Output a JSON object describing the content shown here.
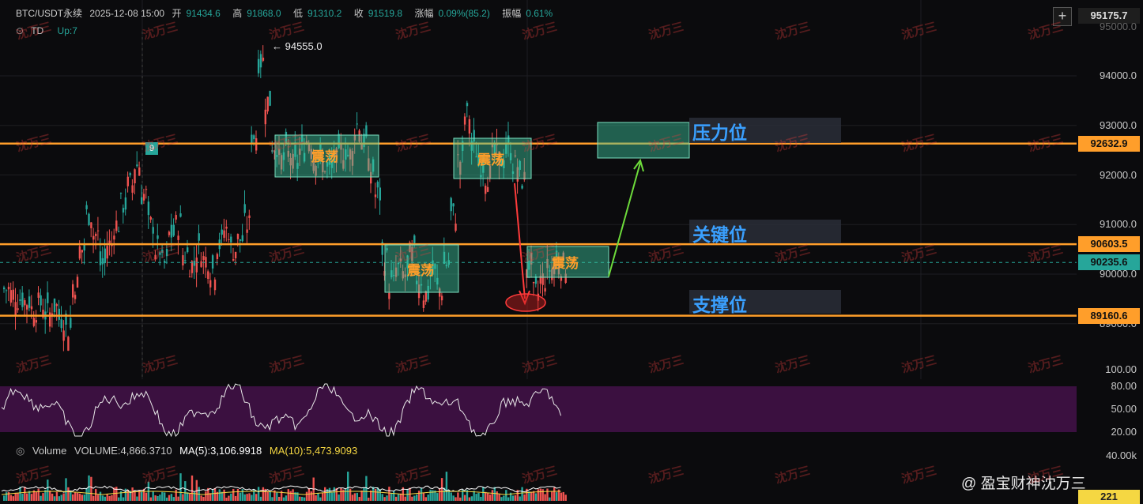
{
  "header": {
    "symbol": "BTC/USDT永续",
    "datetime": "2025-12-08 15:00",
    "open_label": "开",
    "open": "91434.6",
    "high_label": "高",
    "high": "91868.0",
    "low_label": "低",
    "low": "91310.2",
    "close_label": "收",
    "close": "91519.8",
    "change_label": "涨幅",
    "change": "0.09%(85.2)",
    "amp_label": "振幅",
    "amp": "0.61%",
    "indicator": "TD",
    "indicator_value": "Up:7"
  },
  "price_axis": {
    "ticks": [
      "94000.0",
      "93000.0",
      "92000.0",
      "91000.0",
      "90000.0",
      "89000.0"
    ],
    "top_price": "95175.7",
    "top_tick": "95000.0",
    "tags": [
      {
        "label": "92632.9",
        "color": "#ff9e2a"
      },
      {
        "label": "90603.5",
        "color": "#ff9e2a"
      },
      {
        "label": "90235.6",
        "color": "#26a69a"
      },
      {
        "label": "89160.6",
        "color": "#ff9e2a"
      }
    ]
  },
  "annotations": {
    "high_marker": "← 94555.0",
    "td_count": "9",
    "resistance": "压力位",
    "key": "关键位",
    "support": "支撑位",
    "range_boxes": [
      "震荡",
      "震荡",
      "震荡",
      "震荡"
    ]
  },
  "oscillator_axis": [
    "100.00",
    "80.00",
    "50.00",
    "20.00"
  ],
  "volume": {
    "label": "Volume",
    "volume_value": "VOLUME:4,866.3710",
    "ma5": "MA(5):3,106.9918",
    "ma10": "MA(10):5,473.9093",
    "axis_top": "40.00k",
    "current": "221"
  },
  "watermark": "沈万三",
  "brand": "@ 盈宝财神沈万三",
  "colors": {
    "up": "#26a69a",
    "down": "#ef5350",
    "level": "#ff9e2a",
    "box_fill": "rgba(60,200,160,0.45)",
    "zone_text": "#3aa0ff",
    "osc_bg": "#3b1040",
    "ma5": "#ffffff",
    "ma10": "#f5d742"
  }
}
